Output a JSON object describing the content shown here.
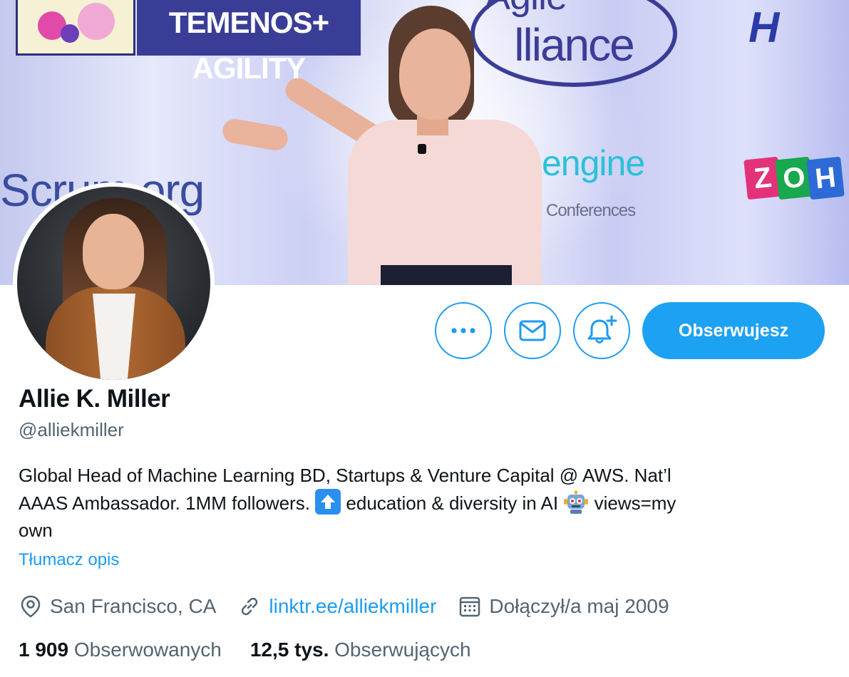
{
  "banner": {
    "logos": {
      "temenos": "TEMENOS+ AGILITY",
      "agile_top": "Agile",
      "agile_main": "lliance",
      "scrum": "Scrum.org",
      "engine": "engine",
      "conferences": "Conferences",
      "h_partial": "H",
      "zoho": [
        "Z",
        "O",
        "H"
      ]
    }
  },
  "profile": {
    "name": "Allie K. Miller",
    "handle": "@alliekmiller",
    "bio_line1": "Global Head of Machine Learning BD, Startups & Venture Capital @ AWS. Nat’l",
    "bio_line2_a": "AAAS Ambassador. 1MM followers. ",
    "bio_line2_b": " education & diversity in AI ",
    "bio_line2_c": " views=my",
    "bio_line3": "own",
    "translate": "Tłumacz opis",
    "location": "San Francisco, CA",
    "website": "linktr.ee/alliekmiller",
    "joined": "Dołączył/a maj 2009"
  },
  "actions": {
    "more_icon": "more-dots-icon",
    "message_icon": "mail-icon",
    "notify_icon": "bell-plus-icon",
    "follow_label": "Obserwujesz"
  },
  "stats": {
    "following_count": "1 909",
    "following_label": "Obserwowanych",
    "followers_count": "12,5 tys.",
    "followers_label": "Obserwujących"
  },
  "colors": {
    "accent": "#1d9bf0",
    "text": "#0f1419",
    "muted": "#536471"
  }
}
